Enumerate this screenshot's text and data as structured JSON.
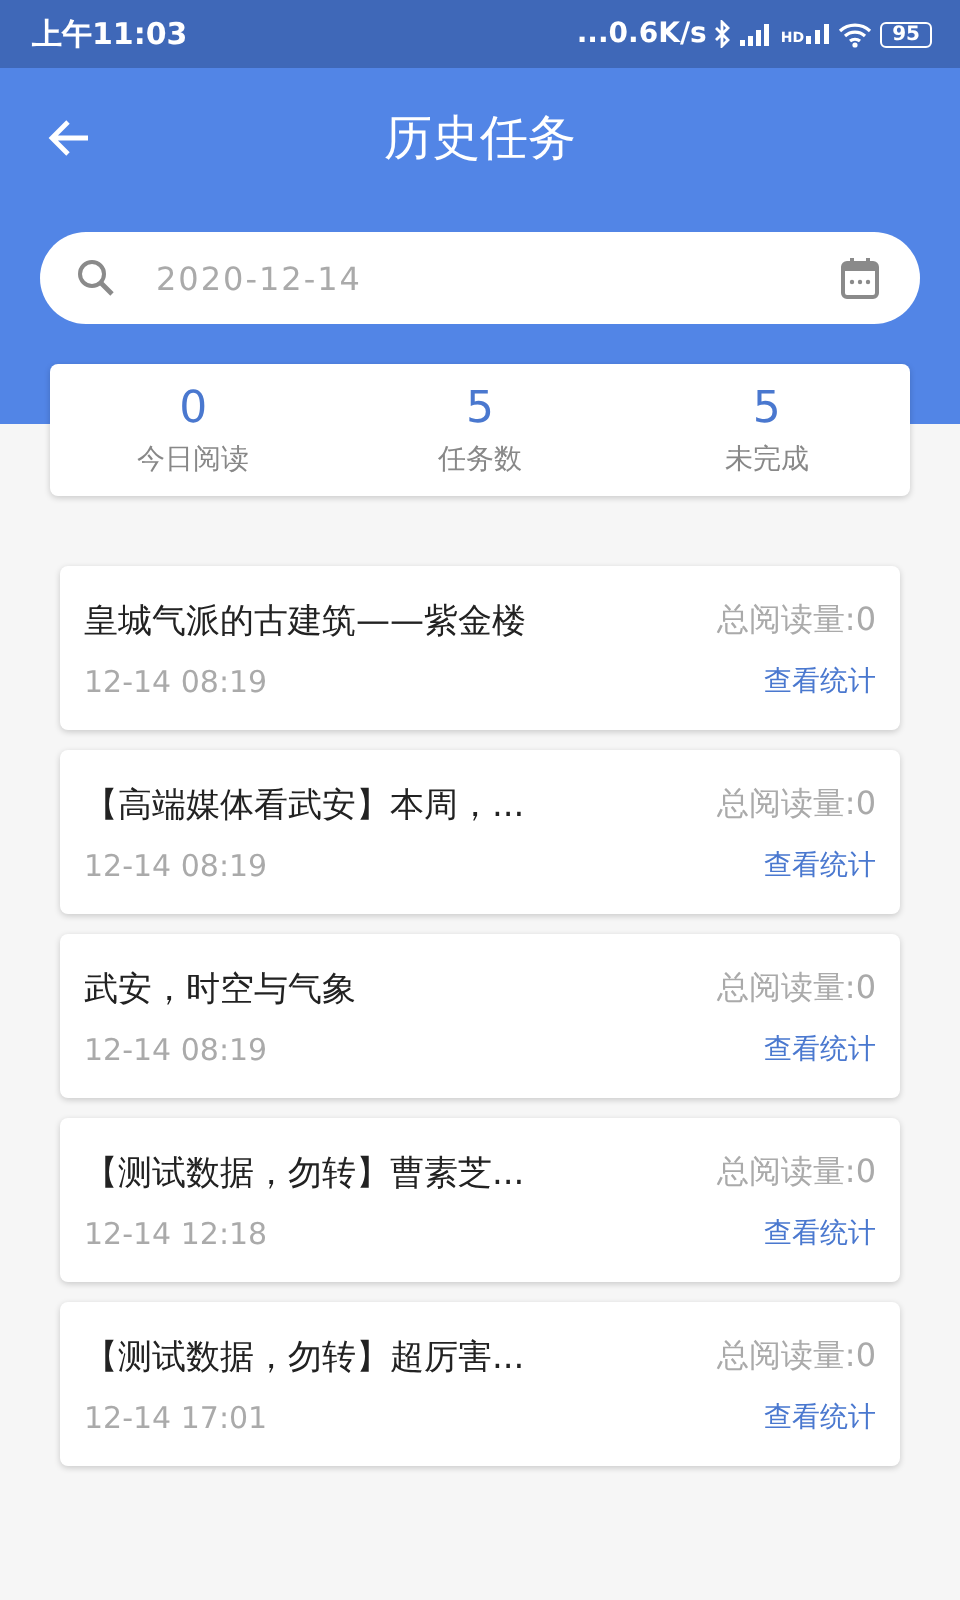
{
  "status_bar": {
    "time": "上午11:03",
    "speed": "...0.6K/s",
    "network_label": "HD",
    "battery": "95"
  },
  "header": {
    "title": "历史任务"
  },
  "search": {
    "value": "2020-12-14"
  },
  "stats": [
    {
      "value": "0",
      "label": "今日阅读"
    },
    {
      "value": "5",
      "label": "任务数"
    },
    {
      "value": "5",
      "label": "未完成"
    }
  ],
  "tasks": [
    {
      "title": "皇城气派的古建筑——紫金楼",
      "time": "12-14 08:19",
      "reads": "总阅读量:0",
      "link": "查看统计"
    },
    {
      "title": "【高端媒体看武安】本周，...",
      "time": "12-14 08:19",
      "reads": "总阅读量:0",
      "link": "查看统计"
    },
    {
      "title": "武安，时空与气象",
      "time": "12-14 08:19",
      "reads": "总阅读量:0",
      "link": "查看统计"
    },
    {
      "title": "【测试数据，勿转】曹素芝...",
      "time": "12-14 12:18",
      "reads": "总阅读量:0",
      "link": "查看统计"
    },
    {
      "title": "【测试数据，勿转】超厉害...",
      "time": "12-14 17:01",
      "reads": "总阅读量:0",
      "link": "查看统计"
    }
  ]
}
